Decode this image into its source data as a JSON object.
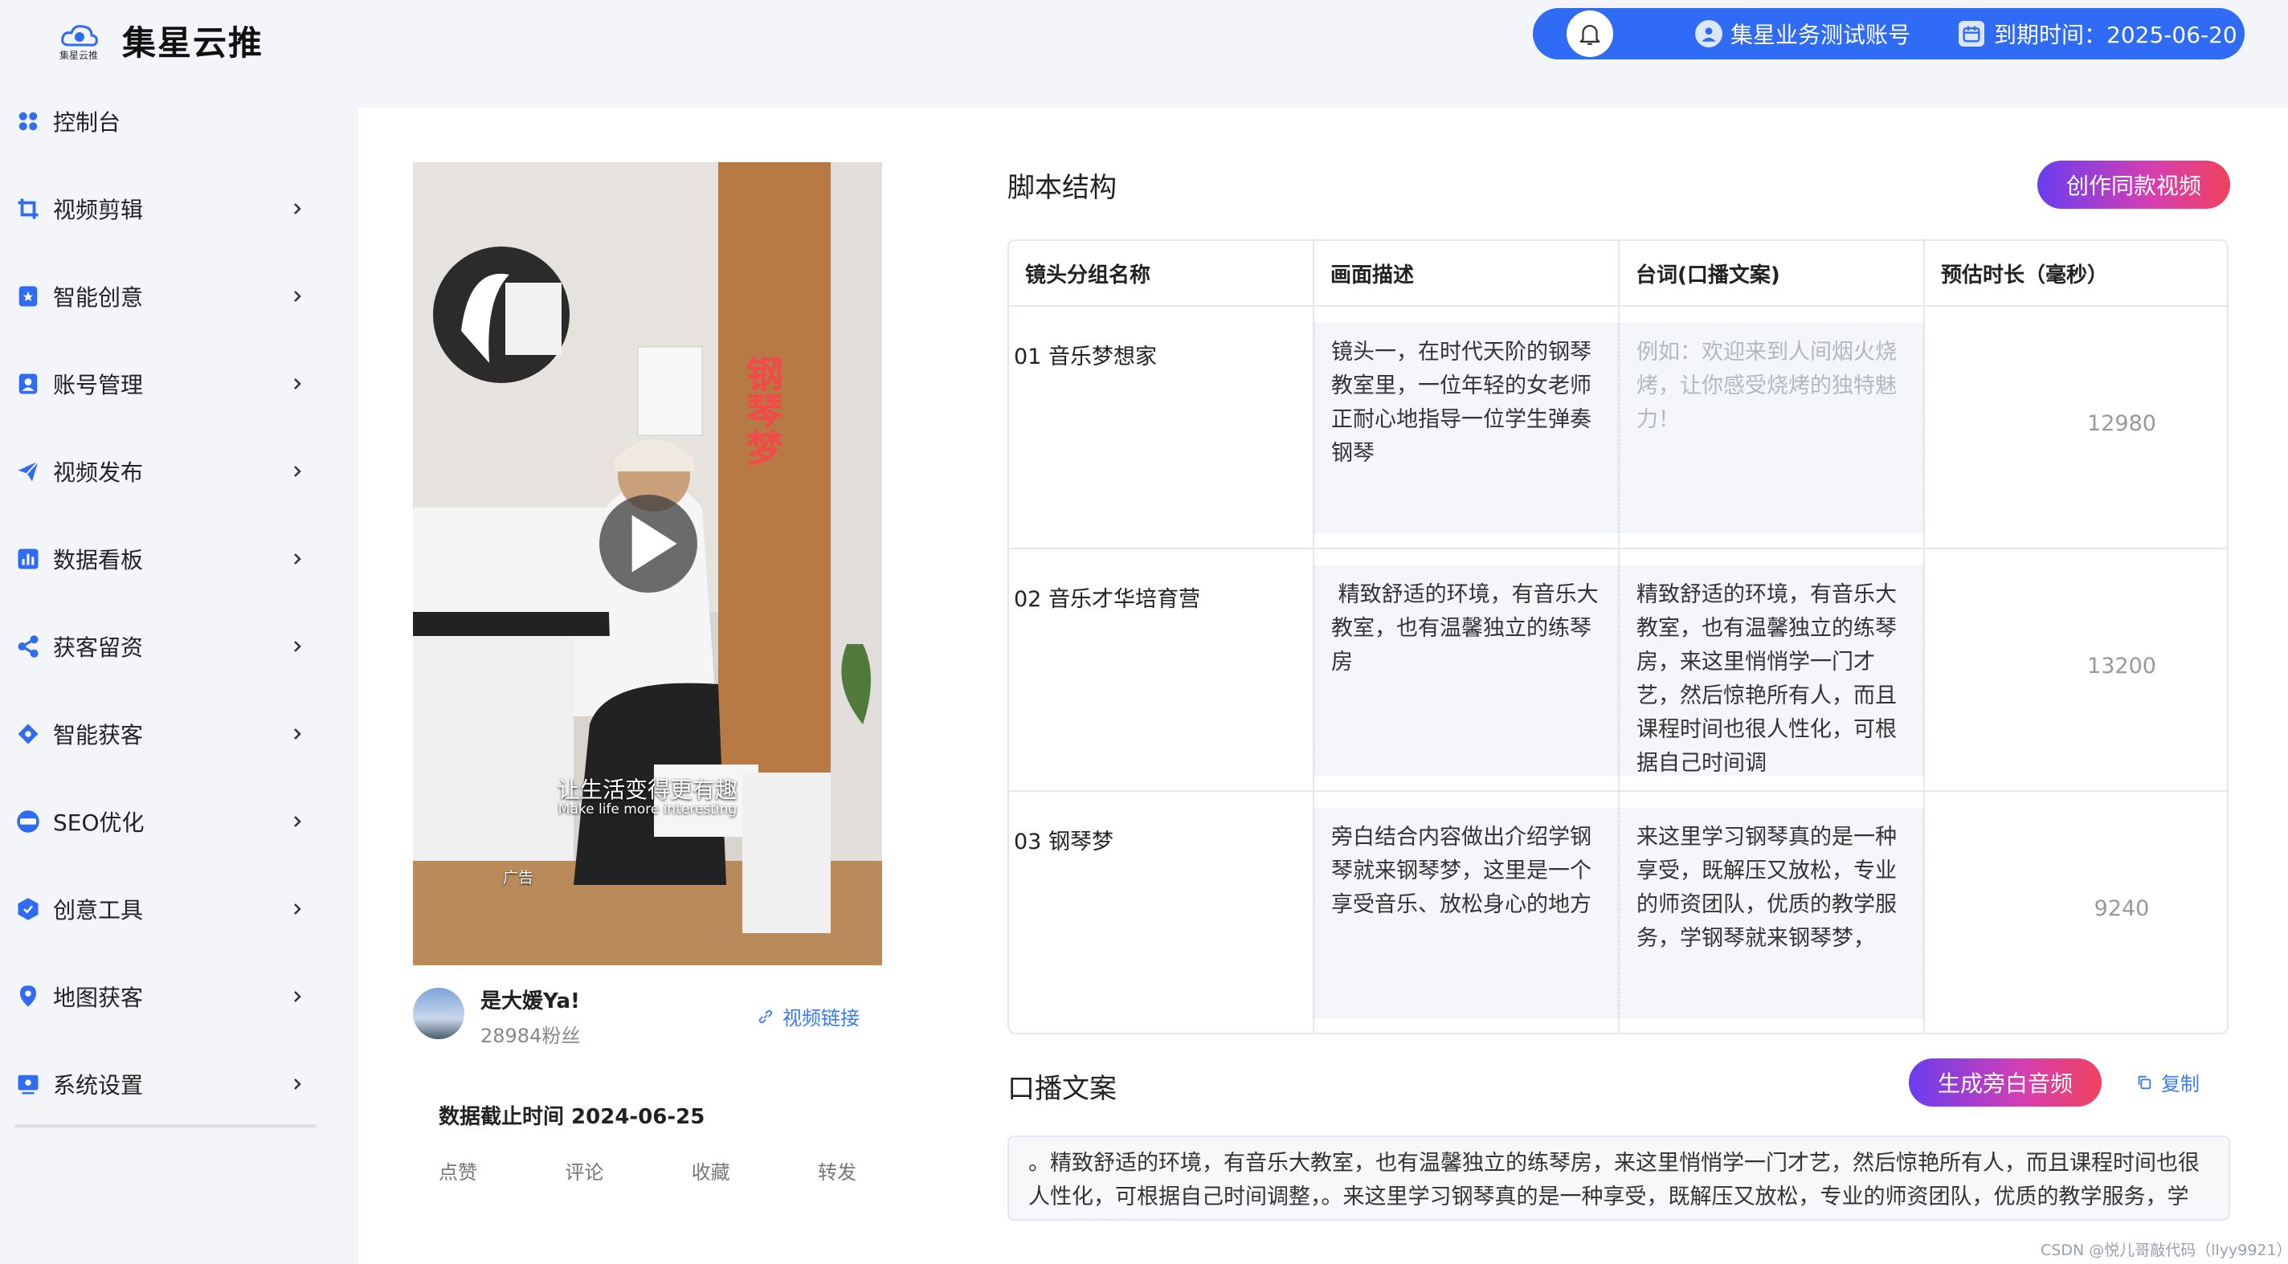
{
  "brand": {
    "title": "集星云推",
    "small_label": "集星云推"
  },
  "user_bar": {
    "account": "集星业务测试账号",
    "expire": "到期时间：2025-06-20"
  },
  "sidebar": {
    "items": [
      {
        "label": "控制台"
      },
      {
        "label": "视频剪辑"
      },
      {
        "label": "智能创意"
      },
      {
        "label": "账号管理"
      },
      {
        "label": "视频发布"
      },
      {
        "label": "数据看板"
      },
      {
        "label": "获客留资"
      },
      {
        "label": "智能获客"
      },
      {
        "label": "SEO优化"
      },
      {
        "label": "创意工具"
      },
      {
        "label": "地图获客"
      },
      {
        "label": "系统设置"
      }
    ]
  },
  "video": {
    "subtitle_cn": "让生活变得更有趣",
    "subtitle_en": "Make life more interesting",
    "ad_tag": "广告",
    "sign_text": "钢琴梦"
  },
  "author": {
    "name": "是大媛Ya!",
    "fans": "28984粉丝",
    "link_label": "视频链接"
  },
  "stats": {
    "date_label": "数据截止时间 2024-06-25",
    "labels": [
      "点赞",
      "评论",
      "收藏",
      "转发"
    ]
  },
  "script": {
    "title": "脚本结构",
    "create_btn": "创作同款视频",
    "headers": [
      "镜头分组名称",
      "画面描述",
      "台词(口播文案)",
      "预估时长（毫秒）"
    ],
    "rows": [
      {
        "name": "01  音乐梦想家",
        "desc": "镜头一，在时代天阶的钢琴教室里，一位年轻的女老师正耐心地指导一位学生弹奏钢琴",
        "line": "例如：欢迎来到人间烟火烧烤，让你感受烧烤的独特魅力！",
        "duration": "12980"
      },
      {
        "name": "02  音乐才华培育营",
        "desc": " 精致舒适的环境，有音乐大教室，也有温馨独立的练琴房",
        "line": "精致舒适的环境，有音乐大教室，也有温馨独立的练琴房，来这里悄悄学一门才艺，然后惊艳所有人，而且课程时间也很人性化，可根据自己时间调",
        "duration": "13200"
      },
      {
        "name": "03  钢琴梦",
        "desc": "旁白结合内容做出介绍学钢琴就来钢琴梦，这里是一个享受音乐、放松身心的地方",
        "line": "来这里学习钢琴真的是一种享受，既解压又放松，专业的师资团队，优质的教学服务，学钢琴就来钢琴梦，",
        "duration": "9240"
      }
    ]
  },
  "narration": {
    "title": "口播文案",
    "gen_btn": "生成旁白音频",
    "copy_label": "复制",
    "text": "。精致舒适的环境，有音乐大教室，也有温馨独立的练琴房，来这里悄悄学一门才艺，然后惊艳所有人，而且课程时间也很人性化，可根据自己时间调整，。来这里学习钢琴真的是一种享受，既解压又放松，专业的师资团队，优质的教学服务，学钢琴就来钢琴梦，"
  },
  "watermark": "CSDN @悦儿哥敲代码（llyy9921）",
  "colors": {
    "primary": "#2f6bf5",
    "link": "#3a7bf7",
    "gradient_start": "#6a3df0",
    "gradient_end": "#f0425e"
  }
}
